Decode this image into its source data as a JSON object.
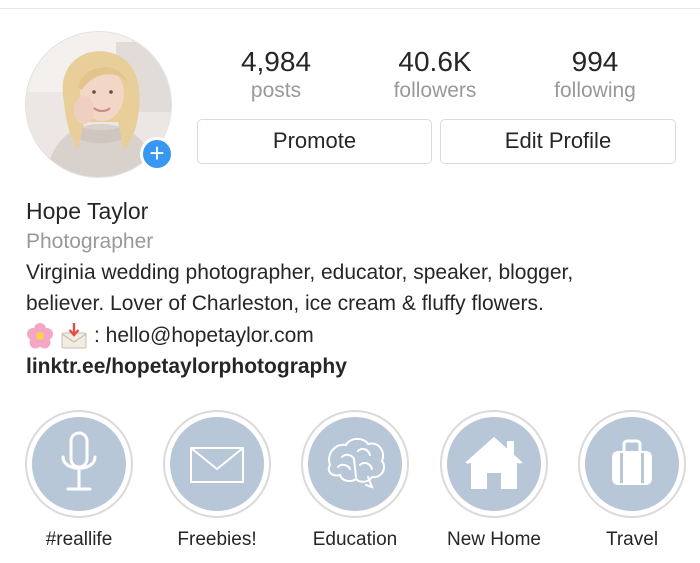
{
  "profile": {
    "posts_count": "4,984",
    "posts_label": "posts",
    "followers_count": "40.6K",
    "followers_label": "followers",
    "following_count": "994",
    "following_label": "following",
    "add_badge": "+"
  },
  "actions": {
    "promote_label": "Promote",
    "edit_profile_label": "Edit Profile"
  },
  "bio": {
    "name": "Hope Taylor",
    "category": "Photographer",
    "line1": "Virginia wedding photographer, educator, speaker, blogger,",
    "line2": "believer. Lover of Charleston, ice cream & fluffy flowers.",
    "contact_text": ": hello@hopetaylor.com",
    "contact_icons": [
      "cherry-blossom-icon",
      "envelope-with-arrow-icon"
    ],
    "link": "linktr.ee/hopetaylorphotography"
  },
  "highlights": [
    {
      "label": "#reallife",
      "icon": "microphone-icon"
    },
    {
      "label": "Freebies!",
      "icon": "envelope-icon"
    },
    {
      "label": "Education",
      "icon": "brain-icon"
    },
    {
      "label": "New Home",
      "icon": "house-icon"
    },
    {
      "label": "Travel",
      "icon": "suitcase-icon"
    }
  ],
  "colors": {
    "accent_blue": "#3897f0",
    "highlight_fill": "#b7c7d8",
    "muted_text": "#999999",
    "border": "#dbdbdb"
  }
}
